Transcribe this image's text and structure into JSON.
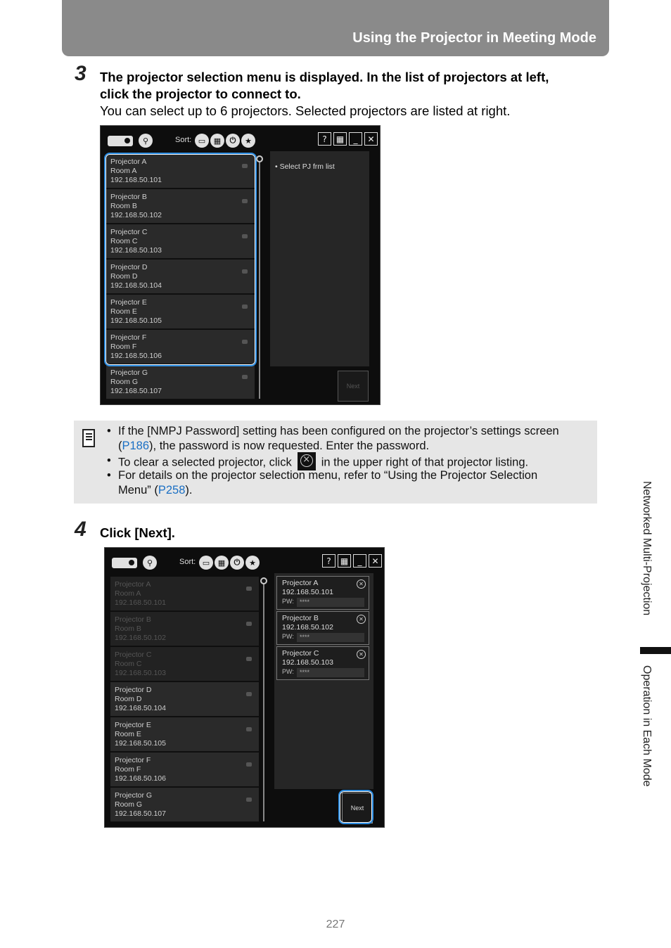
{
  "header": {
    "title": "Using the Projector in Meeting Mode"
  },
  "step3": {
    "number": "3",
    "bold_line1": "The projector selection menu is displayed. In the list of projectors at left,",
    "bold_line2": "click the projector to connect to.",
    "text": "You can select up to 6 projectors. Selected projectors are listed at right."
  },
  "app1": {
    "sort_label": "Sort:",
    "hint": "Select PJ frm list",
    "next": "Next",
    "projectors": [
      {
        "name": "Projector A",
        "room": "Room A",
        "ip": "192.168.50.101"
      },
      {
        "name": "Projector B",
        "room": "Room B",
        "ip": "192.168.50.102"
      },
      {
        "name": "Projector C",
        "room": "Room C",
        "ip": "192.168.50.103"
      },
      {
        "name": "Projector D",
        "room": "Room D",
        "ip": "192.168.50.104"
      },
      {
        "name": "Projector E",
        "room": "Room E",
        "ip": "192.168.50.105"
      },
      {
        "name": "Projector F",
        "room": "Room F",
        "ip": "192.168.50.106"
      },
      {
        "name": "Projector G",
        "room": "Room G",
        "ip": "192.168.50.107"
      }
    ]
  },
  "note": {
    "b1_a": "If the [NMPJ Password] setting has been configured on the projector’s settings screen",
    "b1_b_pre": "(",
    "b1_b_link": "P186",
    "b1_b_post": "), the password is now requested. Enter the password.",
    "b2_pre": "To clear a selected projector, click",
    "b2_post": "in the upper right of that projector listing.",
    "b3_a": "For details on the projector selection menu, refer to “Using the Projector Selection",
    "b3_b_pre": "Menu” (",
    "b3_b_link": "P258",
    "b3_b_post": ")."
  },
  "step4": {
    "number": "4",
    "bold": "Click [Next]."
  },
  "app2": {
    "sort_label": "Sort:",
    "next": "Next",
    "pw_label": "PW:",
    "pw_mask": "****",
    "selected": [
      {
        "name": "Projector A",
        "ip": "192.168.50.101"
      },
      {
        "name": "Projector B",
        "ip": "192.168.50.102"
      },
      {
        "name": "Projector C",
        "ip": "192.168.50.103"
      }
    ]
  },
  "side": {
    "section": "Networked Multi-Projection",
    "chapter": "Operation in Each Mode"
  },
  "page_number": "227",
  "colors": {
    "header_bg": "#8a8a8a",
    "link": "#1a6fc4",
    "highlight": "#2a8be0",
    "note_bg": "#e6e6e6"
  }
}
